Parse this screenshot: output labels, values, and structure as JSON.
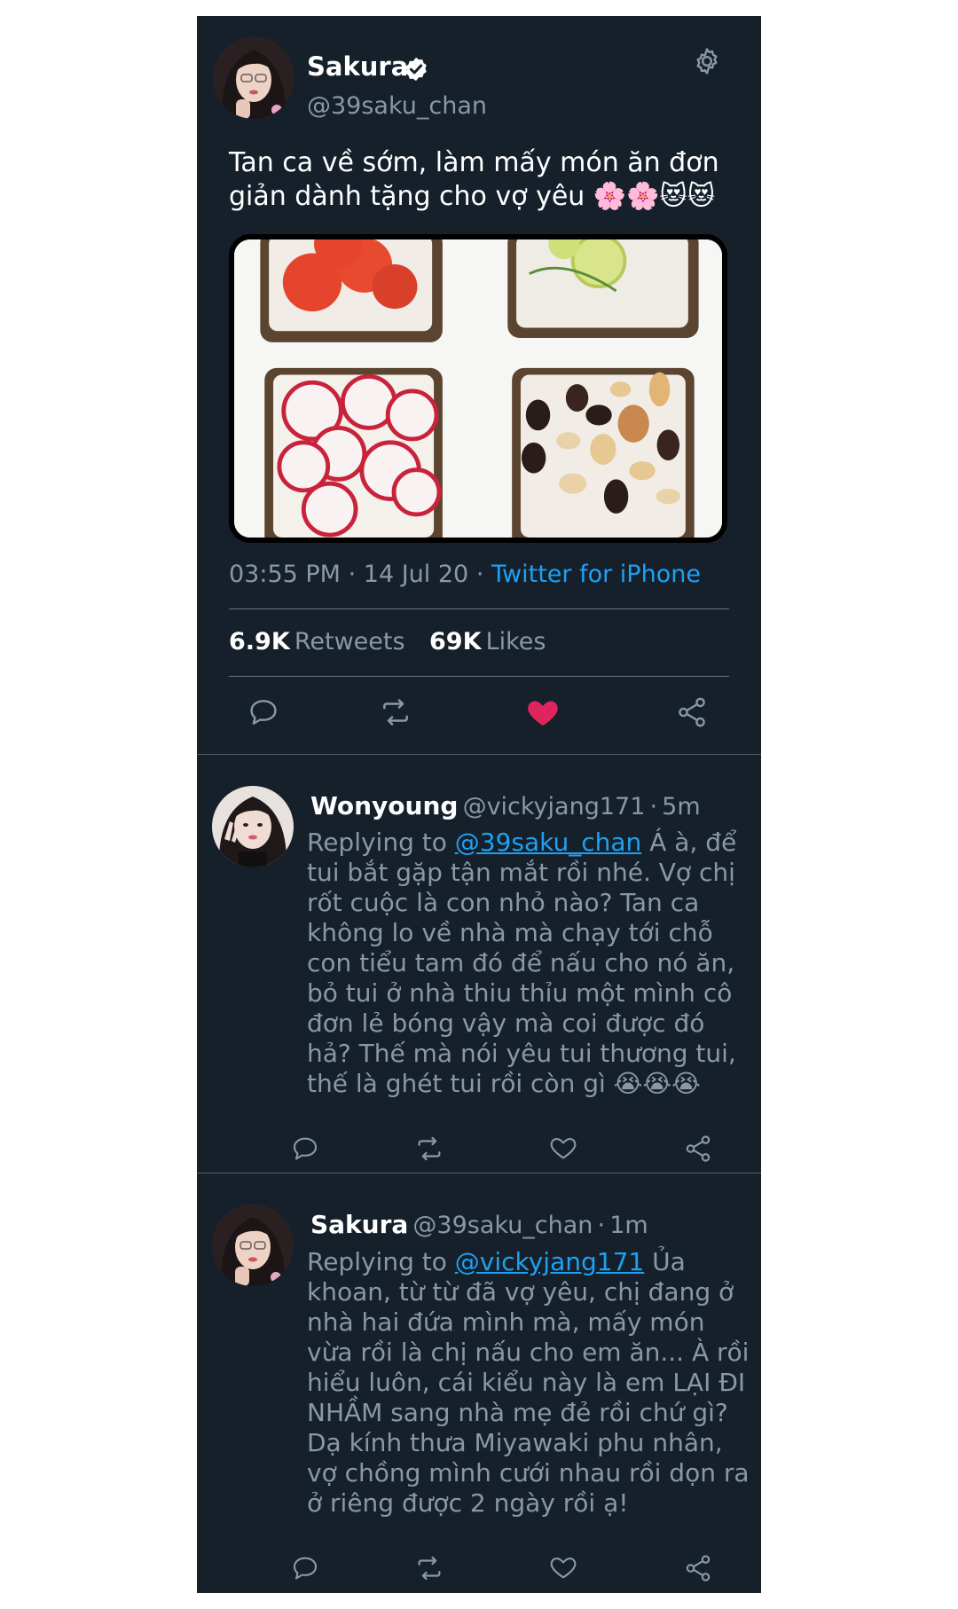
{
  "main_tweet": {
    "author_name": "Sakura",
    "author_handle": "@39saku_chan",
    "text": "Tan ca về sớm, làm mấy món ăn đơn giản dành tặng cho vợ yêu 🌸🌸😻😻",
    "time": "03:55 PM",
    "date": "14 Jul 20",
    "source": "Twitter for iPhone",
    "separator": "·",
    "retweets_count": "6.9K",
    "retweets_label": "Retweets",
    "likes_count": "69K",
    "likes_label": "Likes",
    "liked": true
  },
  "replies": [
    {
      "author_name": "Wonyoung",
      "author_handle": "@vickyjang171",
      "time": "5m",
      "replying_prefix": "Replying to",
      "replying_to": "@39saku_chan",
      "text": "Á à, để tui bắt gặp tận mắt rồi nhé. Vợ chị rốt cuộc là con nhỏ nào? Tan ca không lo về nhà mà chạy tới chỗ con tiểu tam đó để nấu cho nó ăn, bỏ tui ở nhà thiu thỉu một mình cô đơn lẻ bóng vậy mà coi được đó hả? Thế mà nói yêu tui thương tui, thế là ghét tui rồi còn gì 😭😭😭"
    },
    {
      "author_name": "Sakura",
      "author_handle": "@39saku_chan",
      "time": "1m",
      "replying_prefix": "Replying to",
      "replying_to": "@vickyjang171",
      "text": "Ủa khoan, từ từ đã vợ yêu, chị đang ở nhà hai đứa mình mà, mấy món vừa rồi là chị nấu cho em ăn... À rồi hiểu luôn, cái kiểu này là em LẠI ĐI NHẦM sang nhà mẹ đẻ rồi chứ gì? Dạ kính thưa Miyawaki phu nhân, vợ chồng mình cưới nhau rồi dọn ra ở riêng được 2 ngày rồi ạ!"
    }
  ],
  "icons": [
    "verified-badge-icon",
    "gear-icon",
    "reply-icon",
    "retweet-icon",
    "heart-icon",
    "share-icon"
  ],
  "colors": {
    "background": "#15202b",
    "accent": "#1da1f2",
    "like": "#e0245e",
    "muted": "#8899a6"
  }
}
